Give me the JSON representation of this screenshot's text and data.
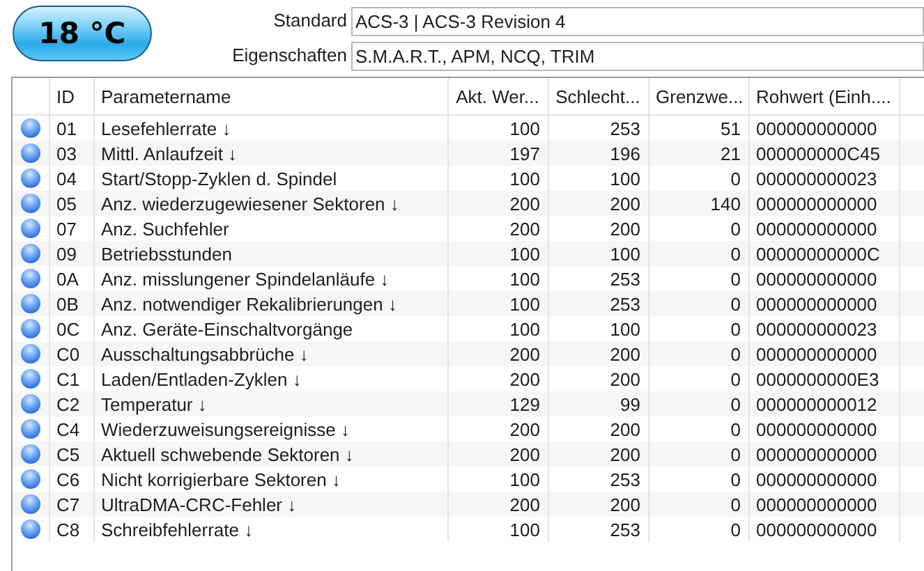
{
  "temperature": "18 °C",
  "properties": [
    {
      "label": "Standard",
      "value": "ACS-3 | ACS-3 Revision 4"
    },
    {
      "label": "Eigenschaften",
      "value": "S.M.A.R.T., APM, NCQ, TRIM"
    }
  ],
  "table": {
    "columns": [
      "ID",
      "Parametername",
      "Akt. Wer...",
      "Schlecht...",
      "Grenzwe...",
      "Rohwert (Einh...."
    ],
    "rows": [
      [
        "01",
        "Lesefehlerrate ↓",
        "100",
        "253",
        "51",
        "000000000000"
      ],
      [
        "03",
        "Mittl. Anlaufzeit ↓",
        "197",
        "196",
        "21",
        "000000000C45"
      ],
      [
        "04",
        "Start/Stopp-Zyklen d. Spindel",
        "100",
        "100",
        "0",
        "000000000023"
      ],
      [
        "05",
        "Anz. wiederzugewiesener Sektoren ↓",
        "200",
        "200",
        "140",
        "000000000000"
      ],
      [
        "07",
        "Anz. Suchfehler",
        "200",
        "200",
        "0",
        "000000000000"
      ],
      [
        "09",
        "Betriebsstunden",
        "100",
        "100",
        "0",
        "00000000000C"
      ],
      [
        "0A",
        "Anz. misslungener Spindelanläufe ↓",
        "100",
        "253",
        "0",
        "000000000000"
      ],
      [
        "0B",
        "Anz. notwendiger Rekalibrierungen ↓",
        "100",
        "253",
        "0",
        "000000000000"
      ],
      [
        "0C",
        "Anz. Geräte-Einschaltvorgänge",
        "100",
        "100",
        "0",
        "000000000023"
      ],
      [
        "C0",
        "Ausschaltungsabbrüche ↓",
        "200",
        "200",
        "0",
        "000000000000"
      ],
      [
        "C1",
        "Laden/Entladen-Zyklen ↓",
        "200",
        "200",
        "0",
        "0000000000E3"
      ],
      [
        "C2",
        "Temperatur ↓",
        "129",
        "99",
        "0",
        "000000000012"
      ],
      [
        "C4",
        "Wiederzuweisungsereignisse ↓",
        "200",
        "200",
        "0",
        "000000000000"
      ],
      [
        "C5",
        "Aktuell schwebende Sektoren ↓",
        "200",
        "200",
        "0",
        "000000000000"
      ],
      [
        "C6",
        "Nicht korrigierbare Sektoren ↓",
        "100",
        "253",
        "0",
        "000000000000"
      ],
      [
        "C7",
        "UltraDMA-CRC-Fehler ↓",
        "200",
        "200",
        "0",
        "000000000000"
      ],
      [
        "C8",
        "Schreibfehlerrate ↓",
        "100",
        "253",
        "0",
        "000000000000"
      ]
    ]
  }
}
